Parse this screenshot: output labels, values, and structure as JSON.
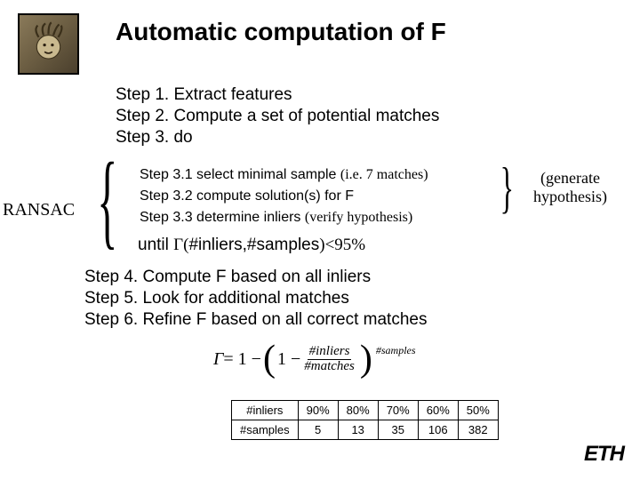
{
  "title": "Automatic computation of F",
  "steps_top": {
    "s1": "Step 1. Extract features",
    "s2": "Step 2. Compute a set of potential matches",
    "s3": "Step 3. do"
  },
  "ransac_label": "RANSAC",
  "substeps": {
    "s31_a": "Step 3.1 select minimal sample",
    "s31_b": "(i.e. 7 matches)",
    "s32": "Step 3.2 compute solution(s) for F",
    "s33_a": "Step 3.3 determine inliers",
    "s33_b": "(verify hypothesis)"
  },
  "gen_hyp": {
    "l1": "(generate",
    "l2": "hypothesis)"
  },
  "until": {
    "prefix": "until ",
    "gamma": "Γ(",
    "args": "#inliers,#samples",
    "suffix": ")<95%"
  },
  "steps_bottom": {
    "s4": "Step 4. Compute F based on all inliers",
    "s5": "Step 5. Look for additional matches",
    "s6": "Step 6. Refine F based on all correct matches"
  },
  "formula": {
    "lhs": "Γ",
    "eq": " = 1 − ",
    "open": "(",
    "one_minus": "1 − ",
    "num": "#inliers",
    "den": "#matches",
    "close": ")",
    "exp": "#samples"
  },
  "table": {
    "row1_label": "#inliers",
    "row2_label": "#samples",
    "cols": [
      {
        "inliers": "90%",
        "samples": "5"
      },
      {
        "inliers": "80%",
        "samples": "13"
      },
      {
        "inliers": "70%",
        "samples": "35"
      },
      {
        "inliers": "60%",
        "samples": "106"
      },
      {
        "inliers": "50%",
        "samples": "382"
      }
    ]
  },
  "eth": "ETH",
  "chart_data": {
    "type": "table",
    "title": "Required #samples vs inlier ratio for Γ≥95%",
    "columns": [
      "#inliers",
      "#samples"
    ],
    "rows": [
      [
        "90%",
        5
      ],
      [
        "80%",
        13
      ],
      [
        "70%",
        35
      ],
      [
        "60%",
        106
      ],
      [
        "50%",
        382
      ]
    ]
  }
}
